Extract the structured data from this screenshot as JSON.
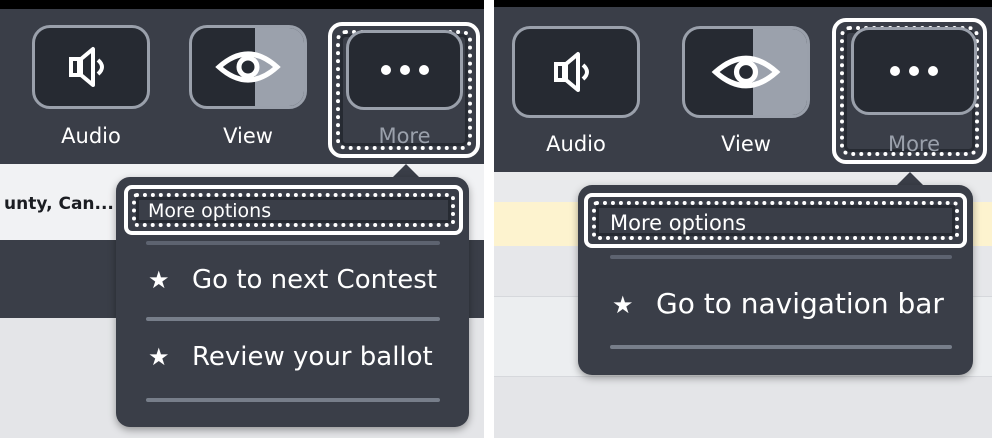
{
  "colors": {
    "toolbar_bg": "#3a3e48",
    "button_bg": "#262a32",
    "button_border": "#9aa0ab",
    "focus_ring": "#ffffff",
    "highlight_strip": "#fdf3cf"
  },
  "left": {
    "toolbar": {
      "audio_label": "Audio",
      "view_label": "View",
      "more_label": "More"
    },
    "county_text": "unty, Can...",
    "popup": {
      "header": "More options",
      "items": [
        {
          "icon": "star-icon",
          "label": "Go to next Contest"
        },
        {
          "icon": "star-icon",
          "label": "Review your ballot"
        }
      ]
    }
  },
  "right": {
    "toolbar": {
      "audio_label": "Audio",
      "view_label": "View",
      "more_label": "More"
    },
    "popup": {
      "header": "More options",
      "items": [
        {
          "icon": "star-icon",
          "label": "Go to navigation bar"
        }
      ]
    }
  }
}
